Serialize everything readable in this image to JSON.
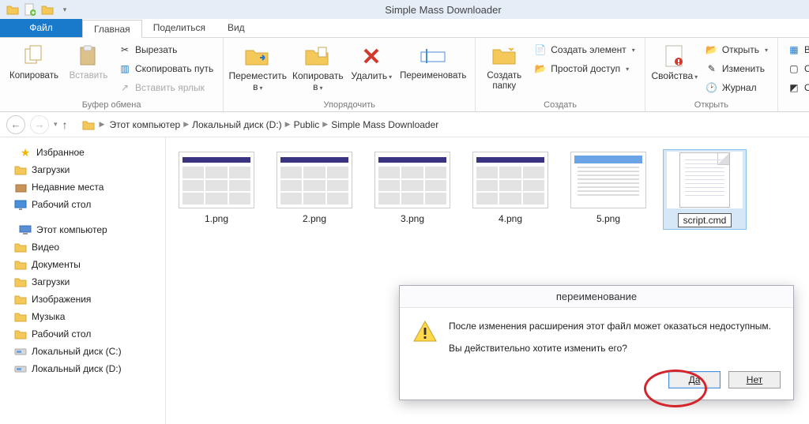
{
  "window": {
    "title": "Simple Mass Downloader"
  },
  "tabs": {
    "file": "Файл",
    "home": "Главная",
    "share": "Поделиться",
    "view": "Вид"
  },
  "ribbon": {
    "clipboard": {
      "copy": "Копировать",
      "paste": "Вставить",
      "cut": "Вырезать",
      "copy_path": "Скопировать путь",
      "paste_shortcut": "Вставить ярлык",
      "group": "Буфер обмена"
    },
    "organize": {
      "move_to": "Переместить в",
      "copy_to": "Копировать в",
      "delete": "Удалить",
      "rename": "Переименовать",
      "group": "Упорядочить"
    },
    "new": {
      "new_folder": "Создать папку",
      "new_item": "Создать элемент",
      "easy_access": "Простой доступ",
      "group": "Создать"
    },
    "open": {
      "properties": "Свойства",
      "open": "Открыть",
      "edit": "Изменить",
      "history": "Журнал",
      "group": "Открыть"
    },
    "select": {
      "select_all": "Выделить",
      "select_none": "Снять в",
      "invert": "Обрати"
    }
  },
  "breadcrumbs": {
    "items": [
      "Этот компьютер",
      "Локальный диск (D:)",
      "Public",
      "Simple Mass Downloader"
    ]
  },
  "sidebar": {
    "favorites": {
      "label": "Избранное",
      "items": [
        {
          "icon": "folder",
          "label": "Загрузки"
        },
        {
          "icon": "recent",
          "label": "Недавние места"
        },
        {
          "icon": "desktop",
          "label": "Рабочий стол"
        }
      ]
    },
    "thispc": {
      "label": "Этот компьютер",
      "items": [
        {
          "icon": "folder",
          "label": "Видео"
        },
        {
          "icon": "folder",
          "label": "Документы"
        },
        {
          "icon": "folder",
          "label": "Загрузки"
        },
        {
          "icon": "folder",
          "label": "Изображения"
        },
        {
          "icon": "folder",
          "label": "Музыка"
        },
        {
          "icon": "folder",
          "label": "Рабочий стол"
        },
        {
          "icon": "drive",
          "label": "Локальный диск (C:)"
        },
        {
          "icon": "drive",
          "label": "Локальный диск (D:)"
        }
      ]
    }
  },
  "files": [
    {
      "name": "1.png",
      "type": "image"
    },
    {
      "name": "2.png",
      "type": "image"
    },
    {
      "name": "3.png",
      "type": "image"
    },
    {
      "name": "4.png",
      "type": "image"
    },
    {
      "name": "5.png",
      "type": "plain"
    },
    {
      "name": "script.cmd",
      "type": "notepad",
      "selected": true
    }
  ],
  "dialog": {
    "title": "переименование",
    "line1": "После изменения расширения этот файл может оказаться недоступным.",
    "line2": "Вы действительно хотите изменить его?",
    "yes": "Да",
    "no": "Нет"
  }
}
